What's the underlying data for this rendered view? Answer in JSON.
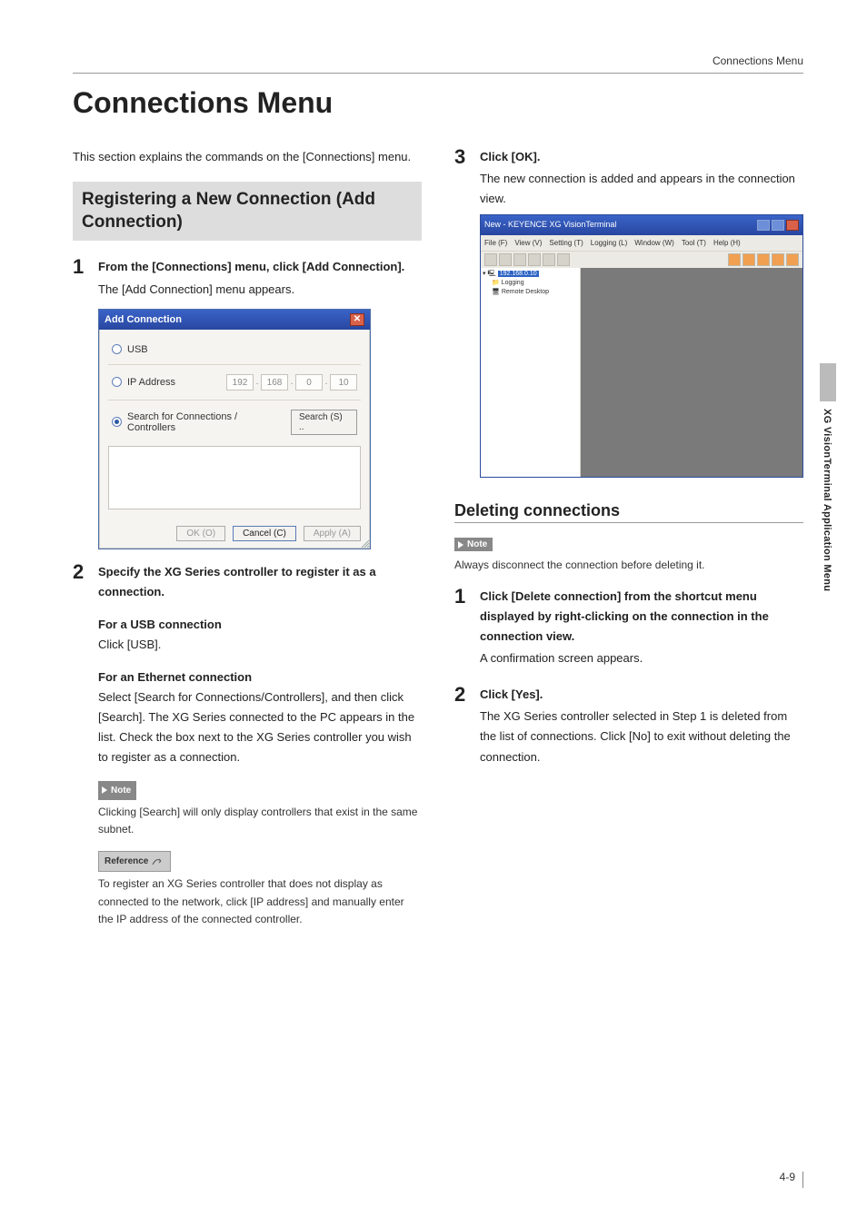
{
  "header": {
    "running_head": "Connections Menu"
  },
  "title": "Connections Menu",
  "intro": "This section explains the commands on the [Connections] menu.",
  "section_register": {
    "heading": "Registering a New Connection (Add Connection)",
    "step1": {
      "num": "1",
      "title": "From the [Connections] menu, click [Add Connection].",
      "desc": "The [Add Connection] menu appears."
    },
    "dialog": {
      "title": "Add Connection",
      "opt_usb": "USB",
      "opt_ip": "IP Address",
      "ip": {
        "a": "192",
        "b": "168",
        "c": "0",
        "d": "10"
      },
      "opt_search": "Search for Connections / Controllers",
      "search_btn": "Search (S) ..",
      "ok": "OK (O)",
      "cancel": "Cancel (C)",
      "apply": "Apply (A)"
    },
    "step2": {
      "num": "2",
      "title": "Specify the XG Series controller to register it as a connection.",
      "usb_head": "For a USB connection",
      "usb_body": "Click [USB].",
      "eth_head": "For an Ethernet connection",
      "eth_body": "Select [Search for Connections/Controllers], and then click [Search]. The XG Series connected to the PC appears in the list. Check the box next to the XG Series controller you wish to register as a connection."
    },
    "note_label": "Note",
    "note_text": "Clicking [Search] will only display controllers that exist in the same subnet.",
    "ref_label": "Reference",
    "ref_text": "To register an XG Series controller that does not display as connected to the network, click [IP address] and manually enter the IP address of the connected controller."
  },
  "right": {
    "step3": {
      "num": "3",
      "title": "Click [OK].",
      "desc": "The new connection is added and appears in the connection view."
    },
    "appwin": {
      "title": "New - KEYENCE XG VisionTerminal",
      "menu": [
        "File (F)",
        "View (V)",
        "Setting (T)",
        "Logging (L)",
        "Window (W)",
        "Tool (T)",
        "Help (H)"
      ],
      "tree": {
        "root": "192.168.0.10",
        "child1": "Logging",
        "child2": "Remote Desktop"
      }
    },
    "deleting": {
      "heading": "Deleting connections",
      "note_label": "Note",
      "note_text": "Always disconnect the connection before deleting it.",
      "step1": {
        "num": "1",
        "title": "Click [Delete connection] from the shortcut menu displayed by right-clicking on the connection in the connection view.",
        "desc": "A confirmation screen appears."
      },
      "step2": {
        "num": "2",
        "title": "Click [Yes].",
        "desc": "The XG Series controller selected in Step 1 is deleted from the list of connections. Click [No] to exit without deleting the connection."
      }
    }
  },
  "side_tab": "XG VisionTerminal Application Menu",
  "page_number": "4-9"
}
